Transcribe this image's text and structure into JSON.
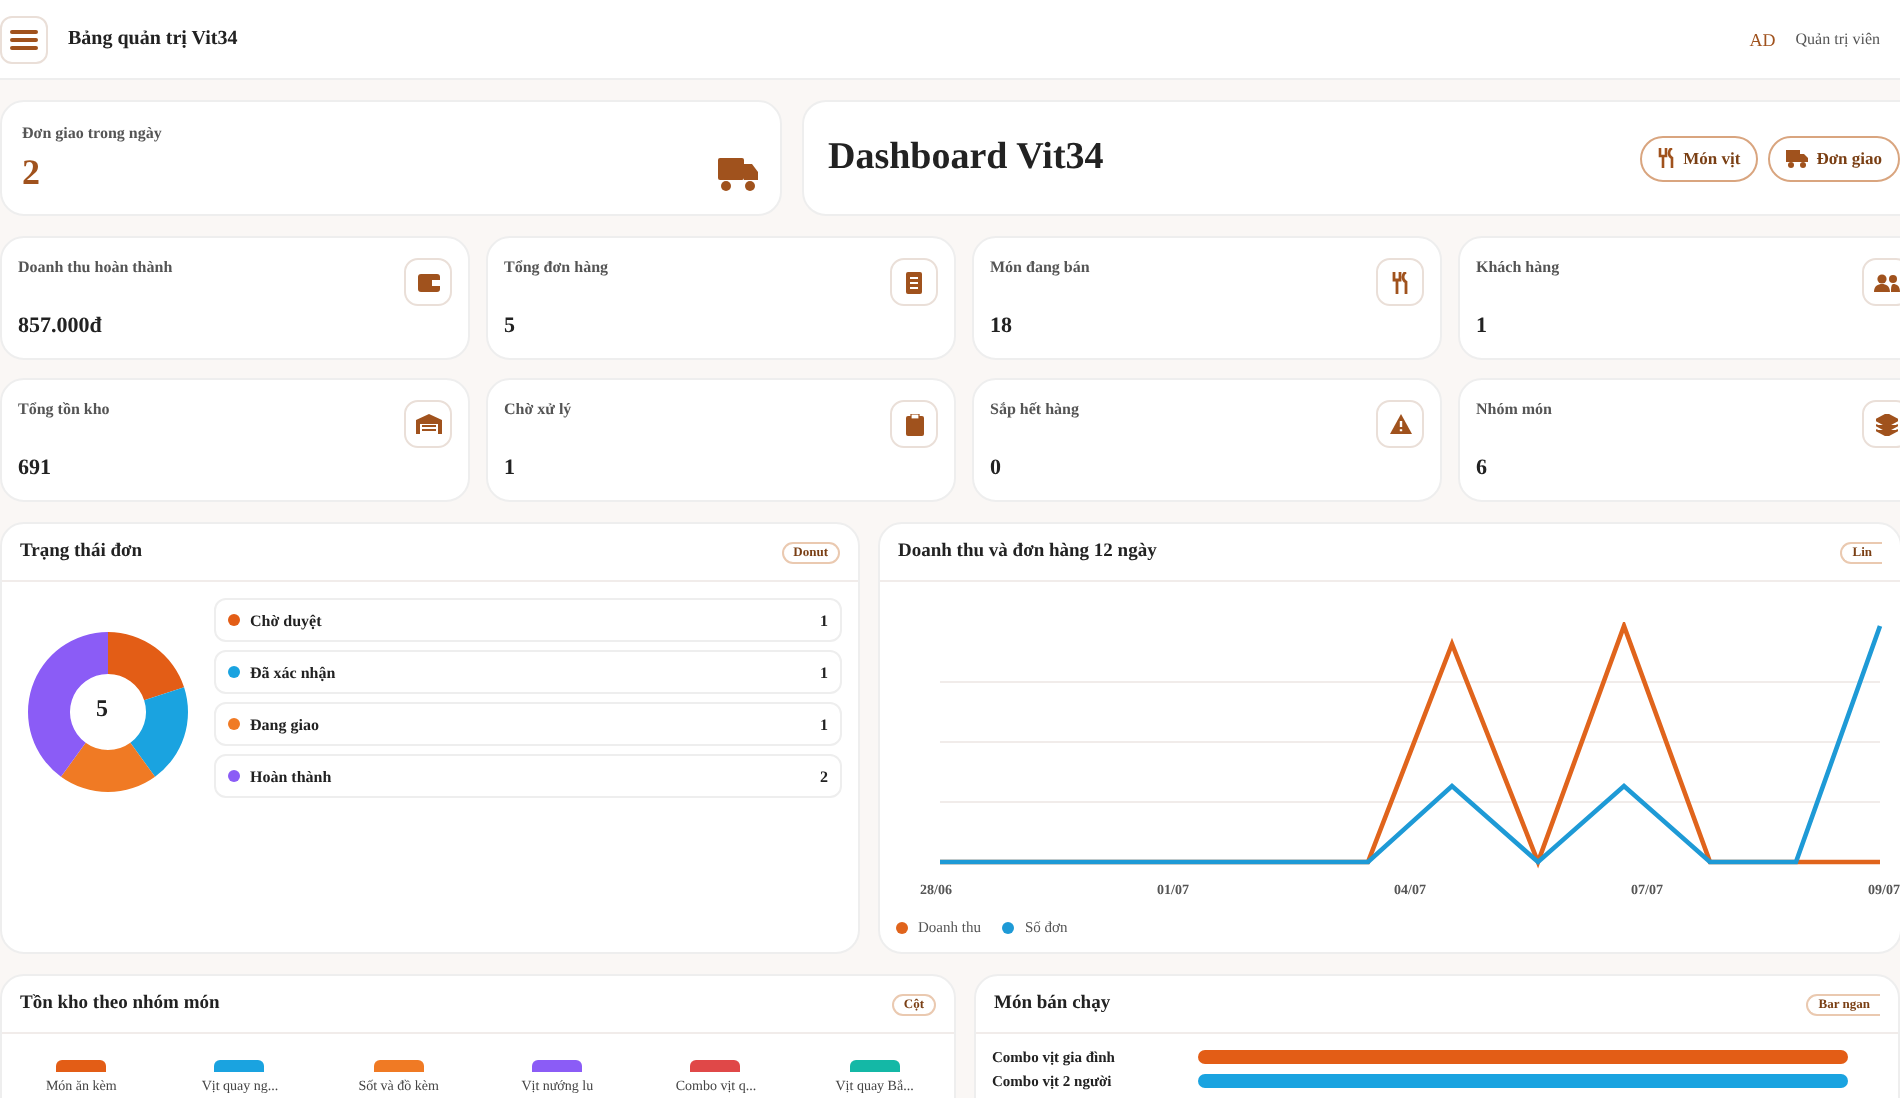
{
  "header": {
    "title": "Bảng quản trị Vit34",
    "user_initials": "AD",
    "user_role": "Quản trị viên"
  },
  "delivery_card": {
    "label": "Đơn giao trong ngày",
    "value": "2"
  },
  "hero": {
    "title": "Dashboard Vit34",
    "buttons": [
      {
        "label": "Món vịt",
        "kind": "food"
      },
      {
        "label": "Đơn giao",
        "kind": "truck"
      }
    ]
  },
  "stats": [
    {
      "label": "Doanh thu hoàn thành",
      "value": "857.000đ",
      "kind": "wallet"
    },
    {
      "label": "Tổng đơn hàng",
      "value": "5",
      "kind": "receipt"
    },
    {
      "label": "Món đang bán",
      "value": "18",
      "kind": "food"
    },
    {
      "label": "Khách hàng",
      "value": "1",
      "kind": "users"
    },
    {
      "label": "Tổng tồn kho",
      "value": "691",
      "kind": "warehouse"
    },
    {
      "label": "Chờ xử lý",
      "value": "1",
      "kind": "clipboard"
    },
    {
      "label": "Sắp hết hàng",
      "value": "0",
      "kind": "warning"
    },
    {
      "label": "Nhóm món",
      "value": "6",
      "kind": "layers"
    }
  ],
  "status_panel": {
    "title": "Trạng thái đơn",
    "badge": "Donut",
    "total": "5",
    "items": [
      {
        "label": "Chờ duyệt",
        "count": "1",
        "color": "#e35d16"
      },
      {
        "label": "Đã xác nhận",
        "count": "1",
        "color": "#1aa3e0"
      },
      {
        "label": "Đang giao",
        "count": "1",
        "color": "#f07a24"
      },
      {
        "label": "Hoàn thành",
        "count": "2",
        "color": "#8b5cf6"
      }
    ]
  },
  "revenue_panel": {
    "title": "Doanh thu và đơn hàng 12 ngày",
    "badge": "Lin",
    "x_labels": [
      "28/06",
      "01/07",
      "04/07",
      "07/07",
      "09/07"
    ],
    "legend": [
      {
        "label": "Doanh thu",
        "color": "#e0641c"
      },
      {
        "label": "Số đơn",
        "color": "#1e9ad6"
      }
    ]
  },
  "stock_panel": {
    "title": "Tồn kho theo nhóm món",
    "badge": "Cột",
    "groups": [
      {
        "label": "Món ăn kèm",
        "color": "#e35d16"
      },
      {
        "label": "Vịt quay ng...",
        "color": "#1aa3e0"
      },
      {
        "label": "Sốt và đồ kèm",
        "color": "#f07a24"
      },
      {
        "label": "Vịt nướng lu",
        "color": "#8b5cf6"
      },
      {
        "label": "Combo vịt q...",
        "color": "#e04848"
      },
      {
        "label": "Vịt quay Bắ...",
        "color": "#14b8a6"
      }
    ]
  },
  "best_panel": {
    "title": "Món bán chạy",
    "badge": "Bar ngan",
    "items": [
      {
        "label": "Combo vịt gia đình",
        "color": "#e35d16"
      },
      {
        "label": "Combo vịt 2 người",
        "color": "#1aa3e0"
      }
    ]
  }
}
